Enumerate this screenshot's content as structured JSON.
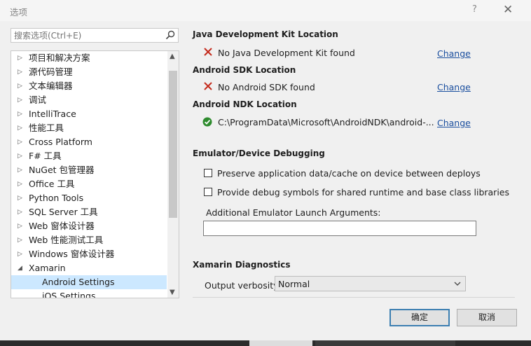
{
  "window": {
    "title": "选项",
    "help_label": "?",
    "close_label": "✕"
  },
  "search": {
    "placeholder": "搜索选项(Ctrl+E)",
    "icon": "search-icon"
  },
  "tree": {
    "items": [
      {
        "label": "项目和解决方案",
        "arrow": "▷"
      },
      {
        "label": "源代码管理",
        "arrow": "▷"
      },
      {
        "label": "文本编辑器",
        "arrow": "▷"
      },
      {
        "label": "调试",
        "arrow": "▷"
      },
      {
        "label": "IntelliTrace",
        "arrow": "▷"
      },
      {
        "label": "性能工具",
        "arrow": "▷"
      },
      {
        "label": "Cross Platform",
        "arrow": "▷"
      },
      {
        "label": "F# 工具",
        "arrow": "▷"
      },
      {
        "label": "NuGet 包管理器",
        "arrow": "▷"
      },
      {
        "label": "Office 工具",
        "arrow": "▷"
      },
      {
        "label": "Python Tools",
        "arrow": "▷"
      },
      {
        "label": "SQL Server 工具",
        "arrow": "▷"
      },
      {
        "label": "Web 窗体设计器",
        "arrow": "▷"
      },
      {
        "label": "Web 性能测试工具",
        "arrow": "▷"
      },
      {
        "label": "Windows 窗体设计器",
        "arrow": "▷"
      },
      {
        "label": "Xamarin",
        "arrow": "◢"
      },
      {
        "label": "Android Settings",
        "arrow": ""
      },
      {
        "label": "iOS Settings",
        "arrow": ""
      }
    ],
    "selected": "Android Settings"
  },
  "sdk": {
    "jdk_heading": "Java Development Kit Location",
    "jdk_status": "No Java Development Kit found",
    "jdk_change": "Change",
    "android_sdk_heading": "Android SDK Location",
    "android_sdk_status": "No Android SDK found",
    "android_sdk_change": "Change",
    "ndk_heading": "Android NDK Location",
    "ndk_path": "C:\\ProgramData\\Microsoft\\AndroidNDK\\android-...",
    "ndk_change": "Change",
    "error_color": "#c42b1c",
    "ok_color": "#2e8b2e"
  },
  "emulator": {
    "heading": "Emulator/Device Debugging",
    "preserve_label": "Preserve application data/cache on device between deploys",
    "preserve_checked": false,
    "debug_symbols_label": "Provide debug symbols for shared runtime and base class libraries",
    "debug_symbols_checked": false,
    "args_label": "Additional Emulator Launch Arguments:",
    "args_value": ""
  },
  "diagnostics": {
    "heading": "Xamarin Diagnostics",
    "verbosity_label": "Output verbosity:",
    "verbosity_value": "Normal"
  },
  "buttons": {
    "ok": "确定",
    "cancel": "取消"
  }
}
